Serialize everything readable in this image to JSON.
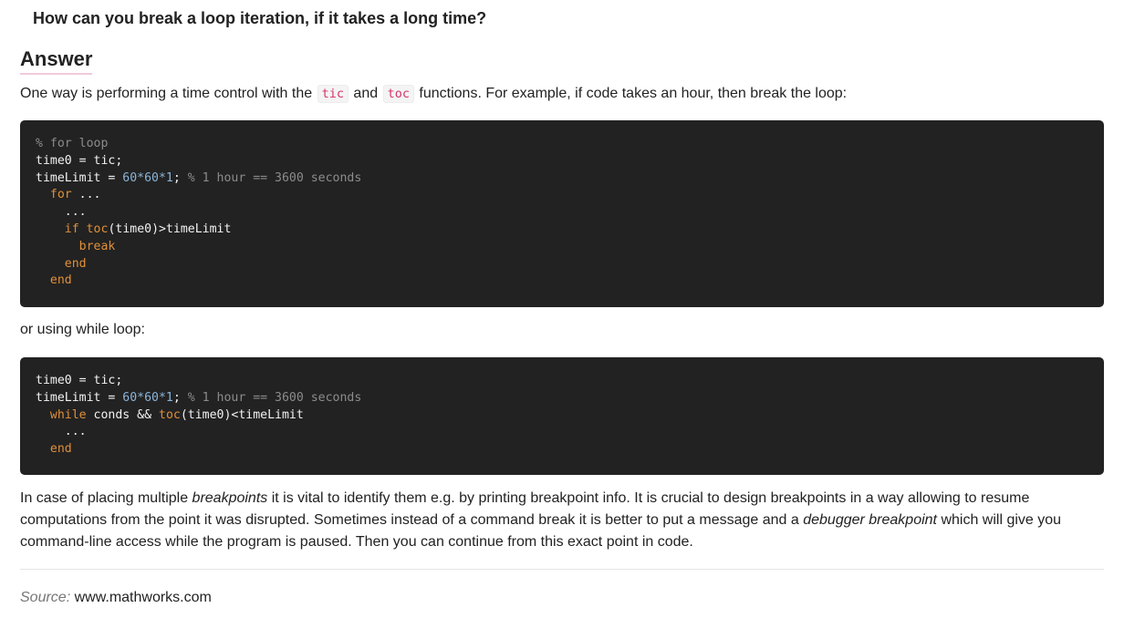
{
  "question": "How can you break a loop iteration, if it takes a long time?",
  "answer_heading": "Answer",
  "intro": {
    "before_tic": "One way is performing a time control with the ",
    "tic": "tic",
    "between": " and ",
    "toc": "toc",
    "after_toc": " functions. For example, if code takes an hour, then break the loop:"
  },
  "code1": {
    "l1": "% for loop",
    "l2": "time0 = tic;",
    "l3_a": "timeLimit = ",
    "l3_num": "60*60*1",
    "l3_b": "; ",
    "l3_comment": "% 1 hour == 3600 seconds",
    "l4_kw": "for",
    "l4_rest": " ...",
    "l5": "...",
    "l6_kw": "if",
    "l6_sp": " ",
    "l6_fn": "toc",
    "l6_rest": "(time0)>timeLimit",
    "l7_kw": "break",
    "l8_kw": "end",
    "l9_kw": "end"
  },
  "between_text": "or using while loop:",
  "code2": {
    "l1": "time0 = tic;",
    "l2_a": "timeLimit = ",
    "l2_num": "60*60*1",
    "l2_b": "; ",
    "l2_comment": "% 1 hour == 3600 seconds",
    "l3_kw": "while",
    "l3_mid": " conds && ",
    "l3_fn": "toc",
    "l3_rest": "(time0)<timeLimit",
    "l4": "...",
    "l5_kw": "end"
  },
  "closing": {
    "s1": "In case of placing multiple ",
    "em1": "breakpoints",
    "s2": " it is vital to identify them e.g. by printing breakpoint info. It is crucial to design breakpoints in a way allowing to resume computations from the point it was disrupted. Sometimes instead of a command break it is better to put a message and a ",
    "em2": "debugger breakpoint",
    "s3": " which will give you command-line access while the program is paused. Then you can continue from this exact point in code."
  },
  "source": {
    "label": "Source:",
    "value": "www.mathworks.com"
  }
}
